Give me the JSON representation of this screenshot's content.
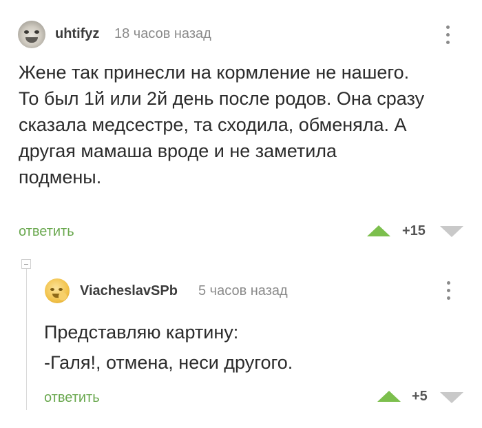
{
  "comments": [
    {
      "username": "uhtifyz",
      "timestamp": "18 часов назад",
      "text_lines": [
        "Жене так принесли на кормление не нашего.",
        "То был 1й или 2й день после родов. Она сразу",
        "сказала медсестре, та сходила, обменяла. А",
        "другая мамаша вроде и не заметила",
        "подмены."
      ],
      "reply_label": "ответить",
      "rating": "+15"
    },
    {
      "username": "ViacheslavSPb",
      "timestamp": "5 часов назад",
      "text_lines": [
        "Представляю картину:",
        "-Галя!, отмена, неси другого."
      ],
      "reply_label": "ответить",
      "rating": "+5"
    }
  ],
  "icons": {
    "menu": "kebab-menu-icon",
    "upvote": "triangle-up-icon",
    "downvote": "triangle-down-icon",
    "collapse": "collapse-minus-icon"
  },
  "colors": {
    "reply_link": "#6aa84f",
    "upvote": "#7cbf4d",
    "downvote": "#c9c9c9",
    "timestamp": "#8a8a8a"
  }
}
